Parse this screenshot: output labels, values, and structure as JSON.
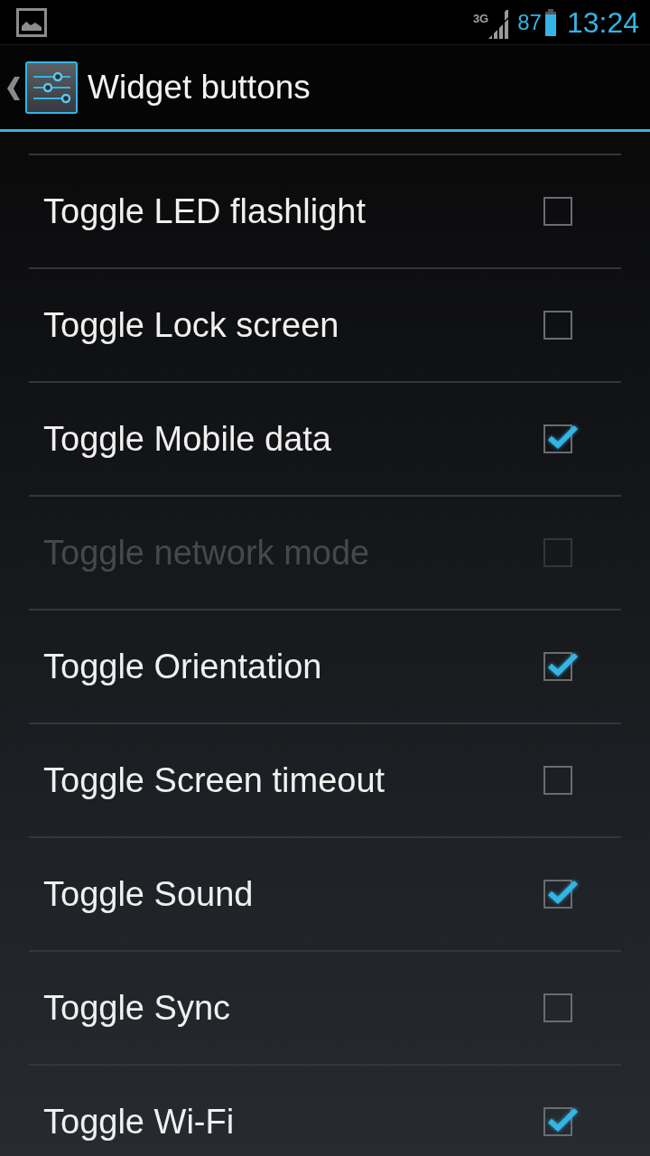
{
  "status_bar": {
    "network_type": "3G",
    "battery_percent": "87",
    "time": "13:24"
  },
  "action_bar": {
    "title": "Widget buttons"
  },
  "items": [
    {
      "label": "Toggle LED flashlight",
      "checked": false,
      "disabled": false
    },
    {
      "label": "Toggle Lock screen",
      "checked": false,
      "disabled": false
    },
    {
      "label": "Toggle Mobile data",
      "checked": true,
      "disabled": false
    },
    {
      "label": "Toggle network mode",
      "checked": false,
      "disabled": true
    },
    {
      "label": "Toggle Orientation",
      "checked": true,
      "disabled": false
    },
    {
      "label": "Toggle Screen timeout",
      "checked": false,
      "disabled": false
    },
    {
      "label": "Toggle Sound",
      "checked": true,
      "disabled": false
    },
    {
      "label": "Toggle Sync",
      "checked": false,
      "disabled": false
    },
    {
      "label": "Toggle Wi-Fi",
      "checked": true,
      "disabled": false
    }
  ]
}
